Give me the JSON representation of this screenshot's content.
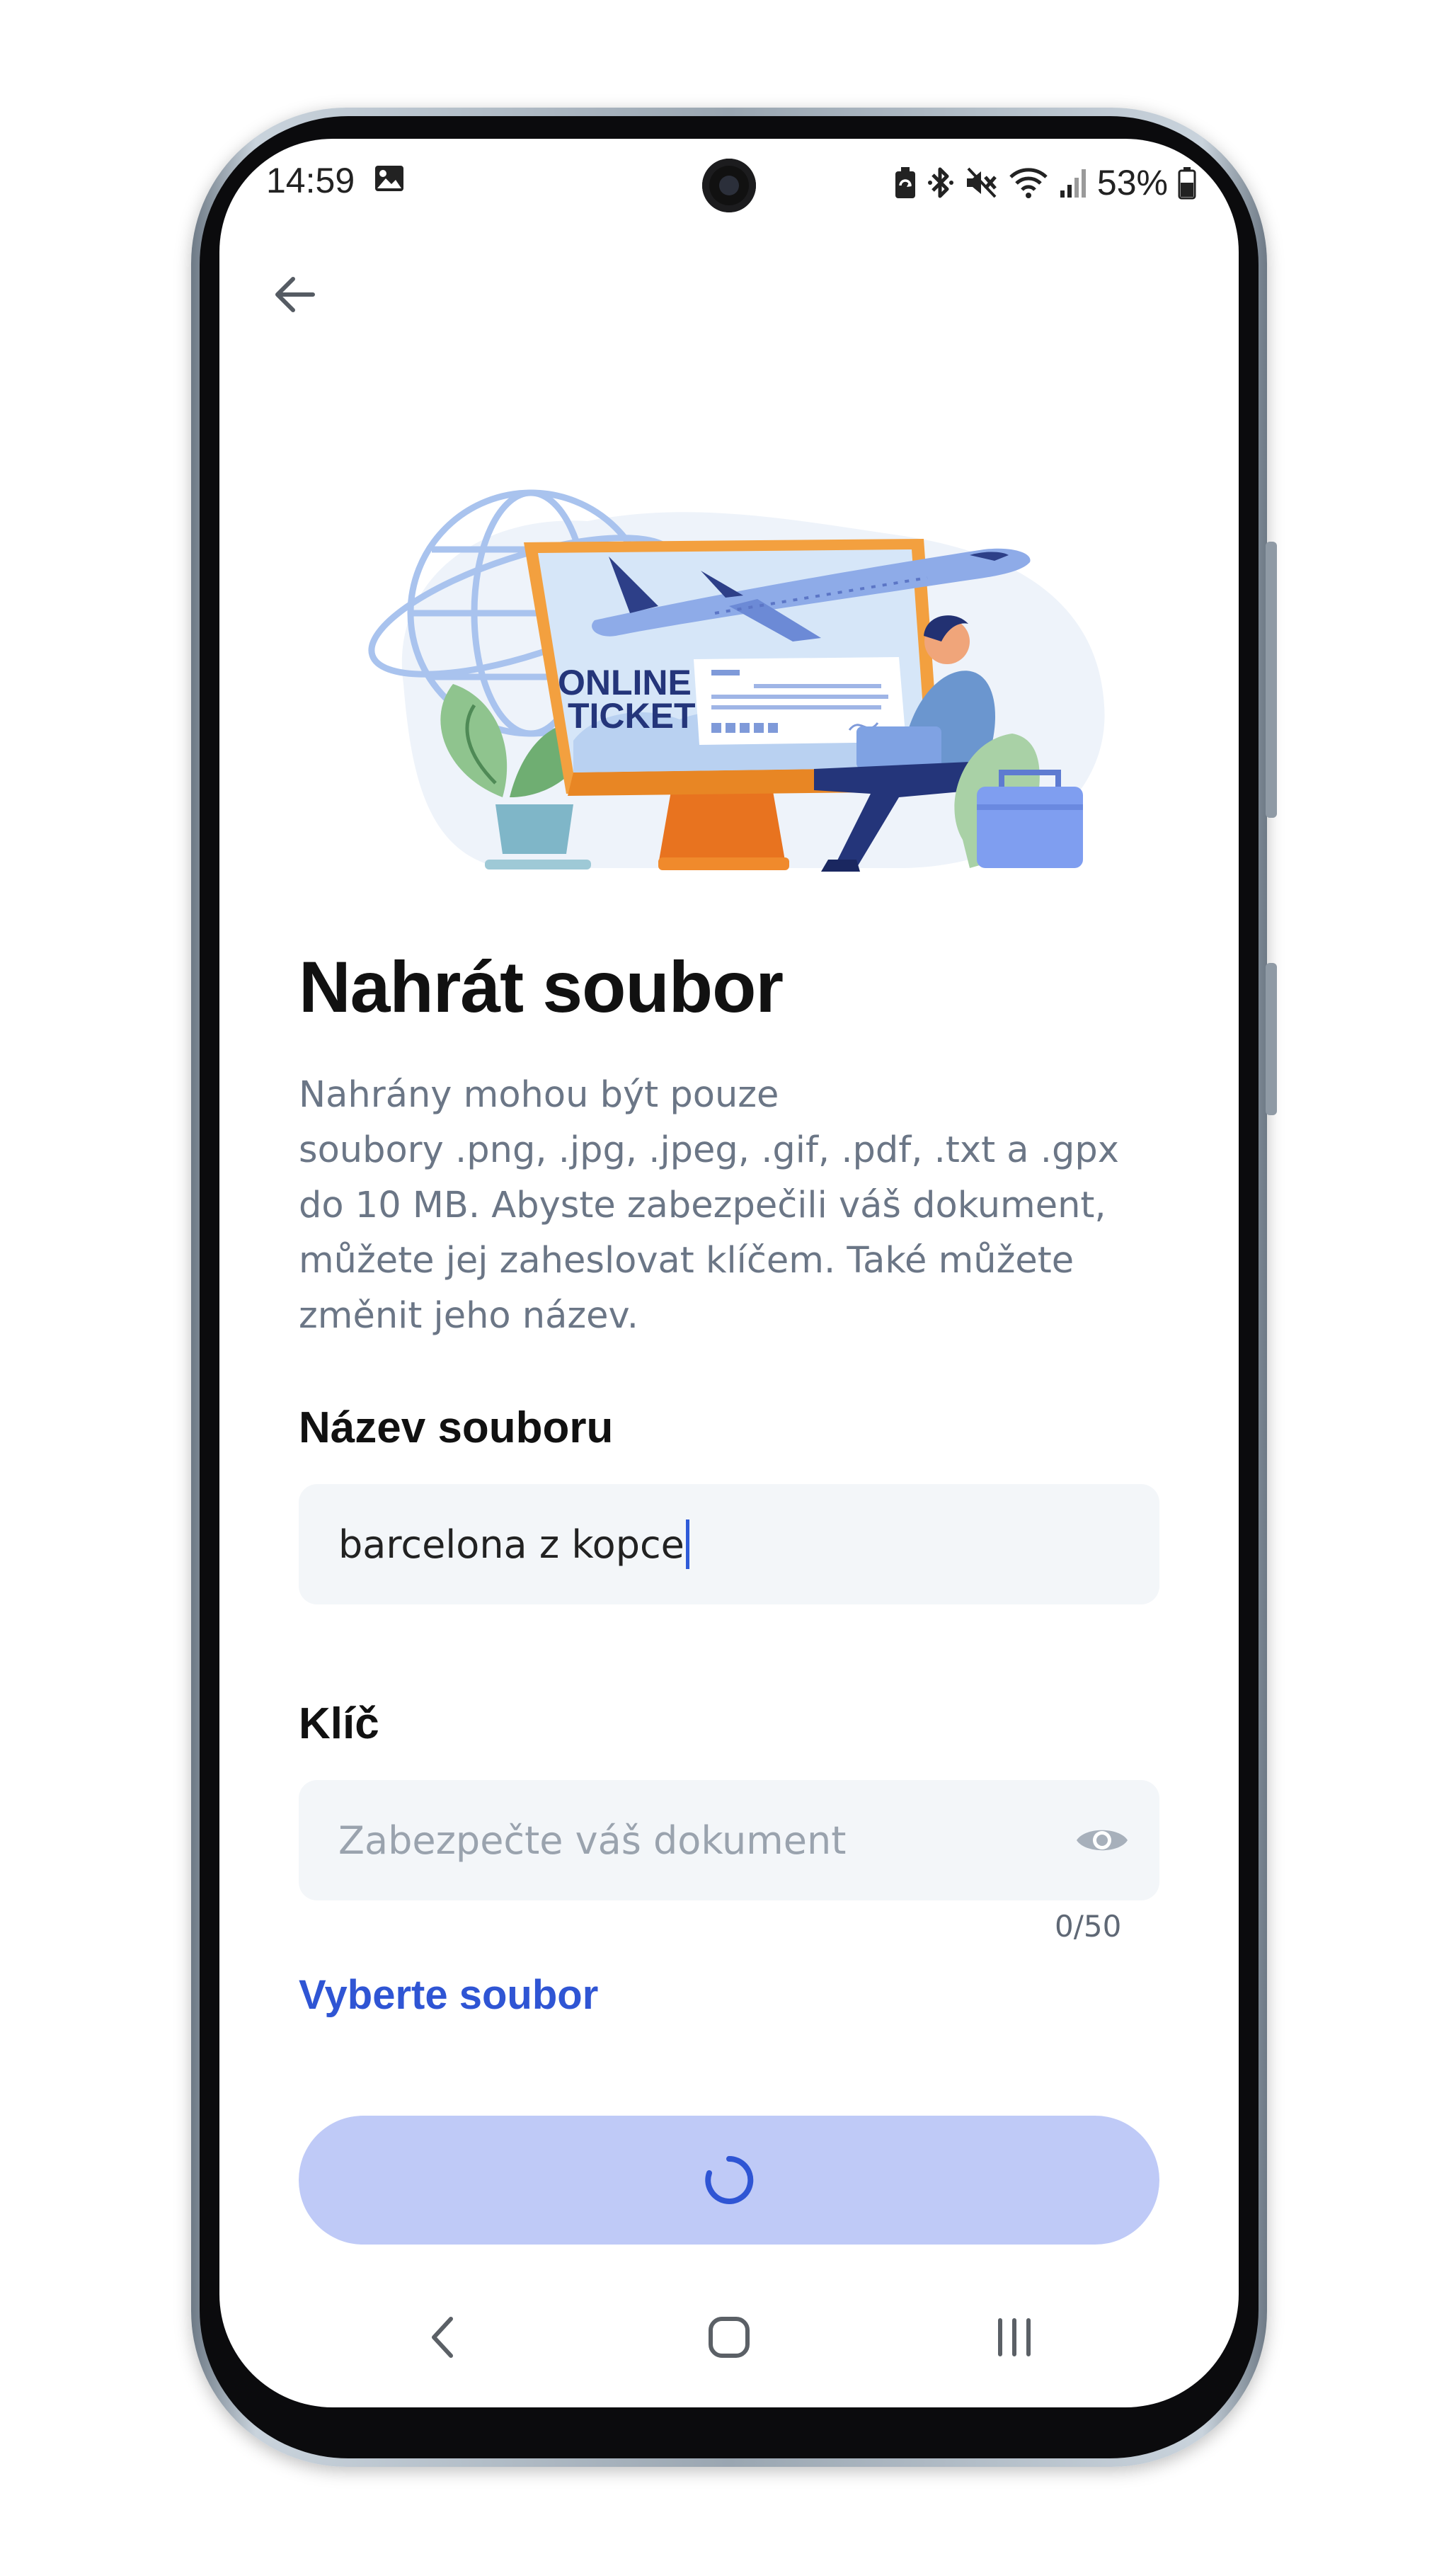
{
  "status_bar": {
    "time": "14:59",
    "battery_percent": "53%",
    "icons": [
      "gallery-icon",
      "battery-saver-icon",
      "bluetooth-icon",
      "mute-icon",
      "wifi-icon",
      "signal-icon",
      "battery-icon"
    ]
  },
  "header": {
    "back_icon": "arrow-left-icon"
  },
  "illustration": {
    "monitor_text_line1": "ONLINE",
    "monitor_text_line2": "TICKET"
  },
  "main": {
    "title": "Nahrát soubor",
    "description": "Nahrány mohou být pouze\nsoubory .png, .jpg, .jpeg, .gif, .pdf, .txt a .gpx\ndo 10 MB. Abyste zabezpečili váš dokument,\nmůžete jej zaheslovat klíčem. Také můžete\nzměnit jeho název.",
    "filename_field": {
      "label": "Název souboru",
      "value": "barcelona z kopce"
    },
    "key_field": {
      "label": "Klíč",
      "placeholder": "Zabezpečte váš dokument",
      "counter": "0/50",
      "eye_icon": "eye-icon"
    },
    "select_file_link": "Vyberte soubor",
    "submit_button": {
      "state": "loading",
      "icon": "spinner-icon"
    }
  },
  "colors": {
    "accent": "#2f55d4",
    "button_disabled": "#bfcaf7",
    "input_bg": "#f3f6f9",
    "description_text": "#6b7686"
  },
  "nav_bar": {
    "icons": [
      "nav-back-icon",
      "nav-home-icon",
      "nav-recents-icon"
    ]
  }
}
